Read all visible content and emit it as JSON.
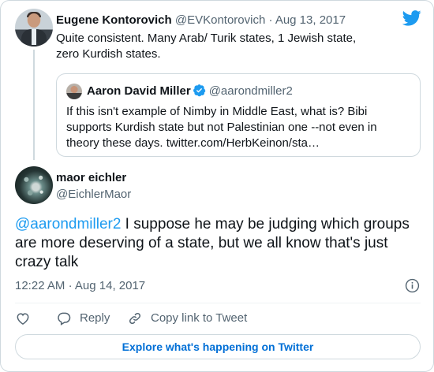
{
  "colors": {
    "accent": "#1d9bf0",
    "text": "#0f1419",
    "muted": "#536471",
    "border": "#cfd9de"
  },
  "parent_tweet": {
    "author_name": "Eugene Kontorovich",
    "author_handle": "@EVKontorovich",
    "separator": "·",
    "date": "Aug 13, 2017",
    "text": "Quite consistent. Many Arab/ Turik states, 1 Jewish state, zero Kurdish states."
  },
  "quoted_tweet": {
    "author_name": "Aaron David Miller",
    "author_handle": "@aarondmiller2",
    "verified_icon": "verified-badge-icon",
    "text": "If this isn't example of Nimby in Middle East, what is? Bibi supports Kurdish state but not Palestinian one --not even in theory these days. twitter.com/HerbKeinon/sta…"
  },
  "tweet": {
    "author_name": "maor eichler",
    "author_handle": "@EichlerMaor",
    "mention": "@aarondmiller2",
    "text": " I suppose he may be judging which groups are more deserving of a state, but we all know that's just crazy talk",
    "time": "12:22 AM",
    "separator": "·",
    "date": "Aug 14, 2017"
  },
  "icons": {
    "logo": "twitter-bird-icon",
    "info": "info-icon",
    "like": "heart-icon",
    "reply": "reply-bubble-icon",
    "copy": "link-icon"
  },
  "actions": {
    "reply_label": "Reply",
    "copy_label": "Copy link to Tweet"
  },
  "explore_label": "Explore what's happening on Twitter"
}
